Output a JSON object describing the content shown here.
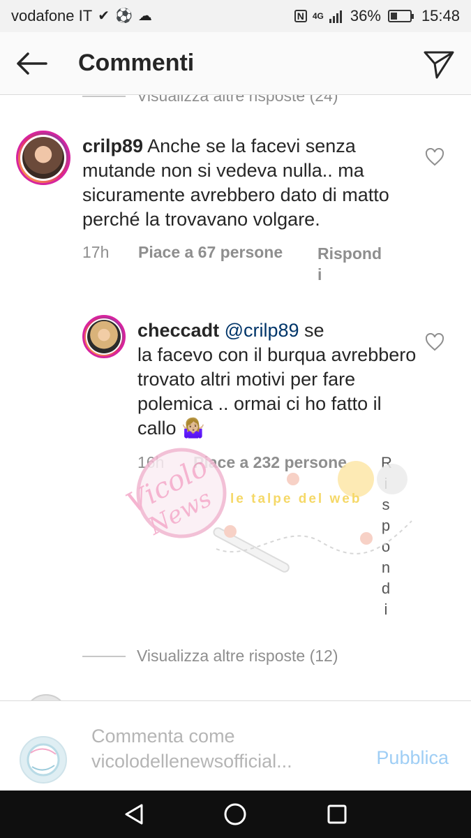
{
  "status_bar": {
    "carrier": "vodafone IT",
    "network": "4G",
    "battery": "36%",
    "battery_level": 0.36,
    "time": "15:48",
    "icons": [
      "check-icon",
      "soccer-ball-icon",
      "cloud-icon",
      "nfc-icon",
      "signal-icon",
      "battery-icon"
    ]
  },
  "header": {
    "title": "Commenti",
    "back_icon": "arrow-left-icon",
    "send_icon": "paper-plane-icon"
  },
  "replies_top": {
    "label": "Visualizza altre risposte (24)"
  },
  "comments": [
    {
      "username": "crilp89",
      "text": "Anche se la facevi senza mutande non si vedeva nulla.. ma sicuramente avrebbero dato di matto perché la trovavano volgare.",
      "time": "17h",
      "likes": "Piace a 67 persone",
      "reply": "Rispond\ni"
    },
    {
      "username": "checcadt",
      "mention": "@crilp89",
      "text": "se\nla facevo con il burqua avrebbero trovato altri motivi per fare polemica .. ormai ci ho fatto il callo",
      "emoji": "🤷🏼‍♀️",
      "time": "16h",
      "likes": "Piace a 232 persone",
      "reply_letters": "Rispondi"
    }
  ],
  "watermark": {
    "logo_text": "Vicolo delle News",
    "blog_text": "le talpe del web"
  },
  "replies_bottom": {
    "label": "Visualizza altre risposte (12)"
  },
  "partial_comment": {
    "text": ""
  },
  "composer": {
    "placeholder": "Commenta come vicolodellenewsofficial...",
    "publish_label": "Pubblica"
  },
  "colors": {
    "accent_disabled": "#9fcef5",
    "text_primary": "#262626",
    "text_secondary": "#8e8e8e",
    "mention": "#003569"
  }
}
